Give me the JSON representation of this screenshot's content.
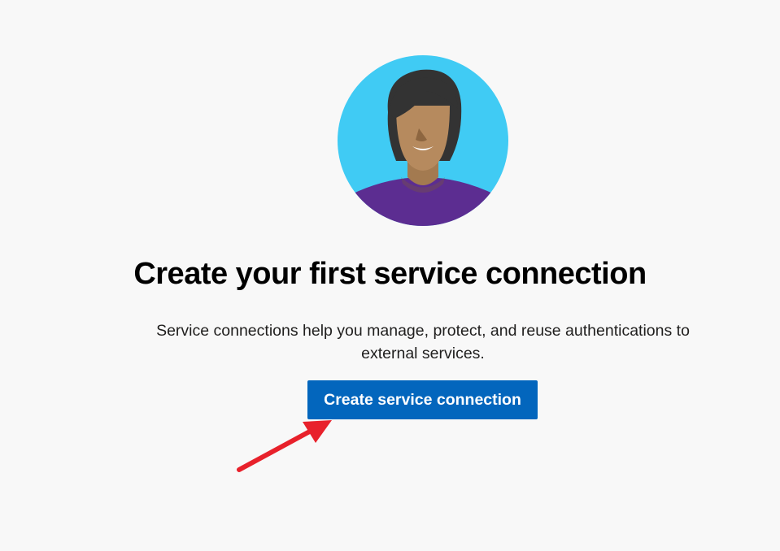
{
  "empty_state": {
    "illustration_icon": "person-avatar-illustration",
    "title": "Create your first service connection",
    "description": "Service connections help you manage, protect, and reuse authentications to external services.",
    "button_label": "Create service connection"
  },
  "annotation": {
    "icon": "red-arrow-icon",
    "color": "#e8212b"
  },
  "colors": {
    "background": "#f8f8f8",
    "accent": "#0366bd",
    "avatar_bg": "#40cbf4",
    "shirt": "#5c2d91",
    "skin": "#b68a5e",
    "hair": "#333333"
  }
}
